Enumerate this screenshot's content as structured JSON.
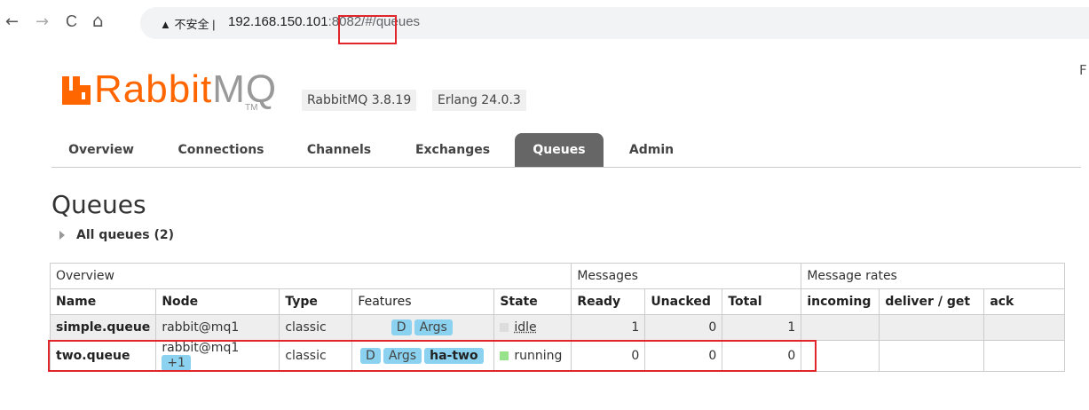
{
  "browser": {
    "back_icon": "←",
    "forward_icon": "→",
    "reload_icon": "C",
    "home_icon": "⌂",
    "security_label": "▲ 不安全 |",
    "url_host": "192.168.150.101",
    "url_rest": ":8082/#/queues"
  },
  "header": {
    "logo_main": "Rabbit",
    "logo_mq": "MQ",
    "tm": "TM",
    "version": "RabbitMQ 3.8.19",
    "erlang": "Erlang 24.0.3",
    "right_edge_text": "F"
  },
  "tabs": [
    {
      "label": "Overview"
    },
    {
      "label": "Connections"
    },
    {
      "label": "Channels"
    },
    {
      "label": "Exchanges"
    },
    {
      "label": "Queues"
    },
    {
      "label": "Admin"
    }
  ],
  "page": {
    "title": "Queues",
    "all_queues": "All queues (2)"
  },
  "table": {
    "groups": {
      "overview": "Overview",
      "messages": "Messages",
      "rates": "Message rates"
    },
    "columns": {
      "name": "Name",
      "node": "Node",
      "type": "Type",
      "features": "Features",
      "state": "State",
      "ready": "Ready",
      "unacked": "Unacked",
      "total": "Total",
      "incoming": "incoming",
      "deliver": "deliver / get",
      "ack": "ack"
    },
    "rows": [
      {
        "name": "simple.queue",
        "node": "rabbit@mq1",
        "node_extra": "",
        "type": "classic",
        "features": [
          "D",
          "Args"
        ],
        "state": "idle",
        "ready": "1",
        "unacked": "0",
        "total": "1"
      },
      {
        "name": "two.queue",
        "node": "rabbit@mq1",
        "node_extra": "+1",
        "type": "classic",
        "features": [
          "D",
          "Args",
          "ha-two"
        ],
        "state": "running",
        "ready": "0",
        "unacked": "0",
        "total": "0"
      }
    ]
  },
  "colors": {
    "brand": "#ff6600",
    "highlight": "#e0262b",
    "pill": "#8ad2f0",
    "running": "#99e28c",
    "idle": "#dddddd"
  }
}
